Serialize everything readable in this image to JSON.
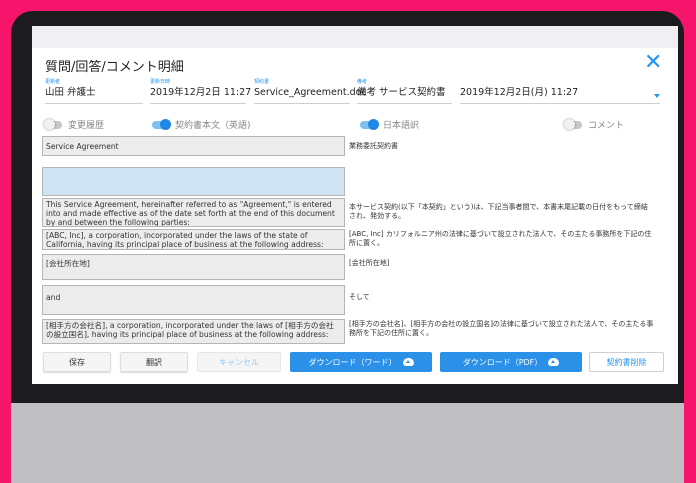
{
  "dialog": {
    "title": "質問/回答/コメント明細",
    "close_glyph": "✕"
  },
  "fields": [
    {
      "label": "更新者",
      "value": "山田 弁護士"
    },
    {
      "label": "更新日時",
      "value": "2019年12月2日 11:27"
    },
    {
      "label": "契約書",
      "value": "Service_Agreement.doc"
    },
    {
      "label": "備考",
      "value": "備考 サービス契約書"
    },
    {
      "label": "",
      "value": "2019年12月2日(月) 11:27"
    }
  ],
  "toggles": [
    {
      "label": "変更履歴",
      "on": false
    },
    {
      "label": "契約書本文（英語)",
      "on": true
    },
    {
      "label": "日本語訳",
      "on": true
    },
    {
      "label": "コメント",
      "on": false
    }
  ],
  "rows": [
    {
      "source": "Service Agreement",
      "target": "業務委託契約書",
      "highlight": false
    },
    {
      "source": "",
      "target": "",
      "highlight": true
    },
    {
      "source": "This Service Agreement, hereinafter referred to as \"Agreement,\" is entered into and made effective as of the date set forth at the end of this document by and between the following parties:",
      "target": "本サービス契約(以下「本契約」という)は、下記当事者間で、本書末尾記載の日付をもって締結され、発効する。",
      "highlight": false
    },
    {
      "source": "[ABC, Inc], a corporation, incorporated under the laws of the state of California, having its principal place of business at the following address:",
      "target": "[ABC, Inc] カリフォルニア州の法律に基づいて設立された法人で、その主たる事務所を下記の住所に置く。",
      "highlight": false
    },
    {
      "source": "[会社所在地]",
      "target": "[会社所在地]",
      "highlight": false
    },
    {
      "source": "and",
      "target": "そして",
      "highlight": false
    },
    {
      "source": "[相手方の会社名], a corporation, incorporated under the laws of [相手方の会社の設立国名], having its principal place of business at the following address:",
      "target": "[相手方の会社名]、[相手方の会社の設立国名]の法律に基づいて設立された法人で、その主たる事務所を下記の住所に置く。",
      "highlight": false
    }
  ],
  "buttons": {
    "save": "保存",
    "translate": "翻訳",
    "cancel": "キャンセル",
    "download_word": "ダウンロード（ワード）",
    "download_pdf": "ダウンロード（PDF）",
    "delete_contract": "契約書削除"
  },
  "colors": {
    "accent": "#2196f3",
    "background": "#f7146b"
  }
}
